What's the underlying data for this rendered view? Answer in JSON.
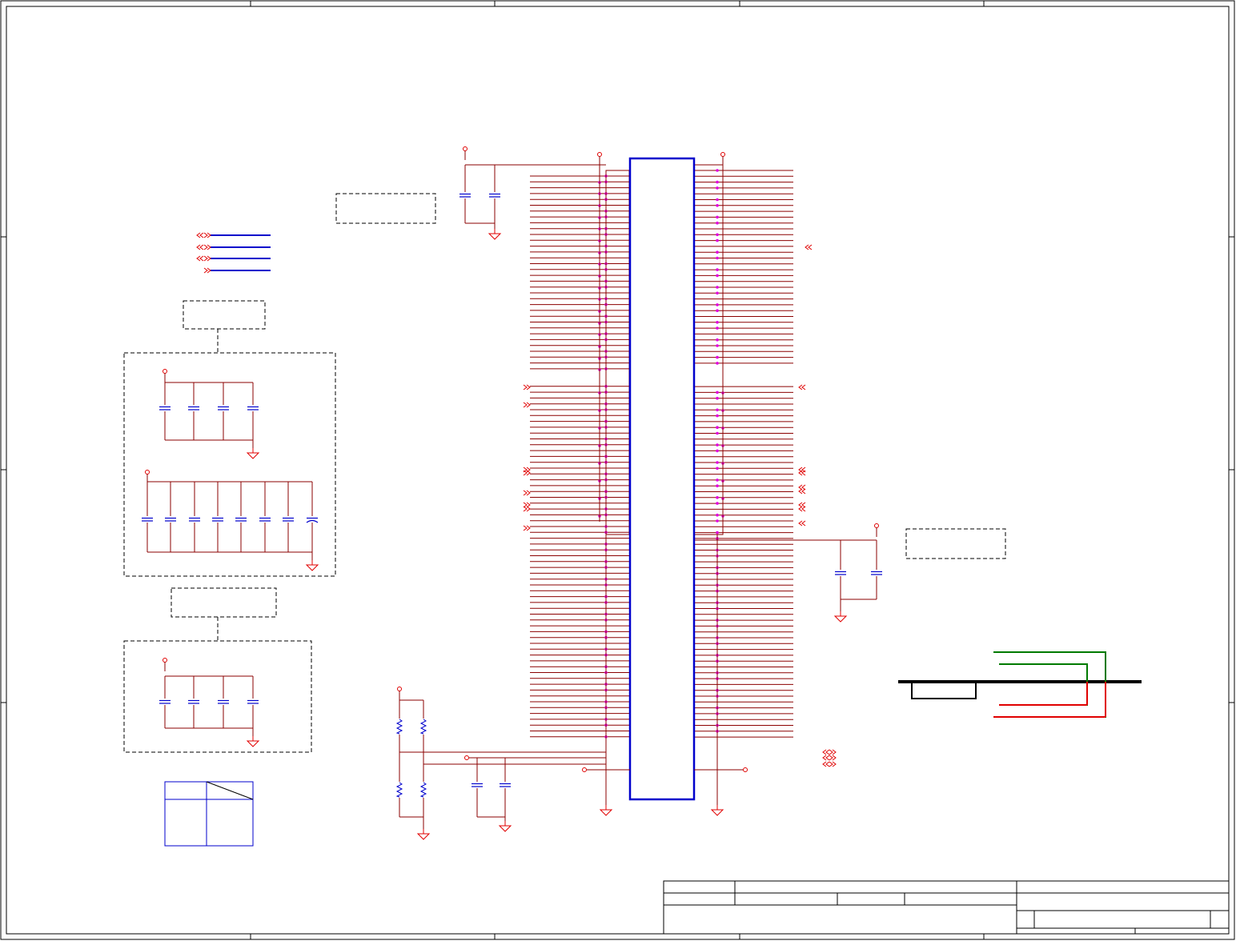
{
  "colors": {
    "wire": "#8b0000",
    "net": "#e00000",
    "junction": "#e000e0",
    "part": "#0000cc",
    "frame": "#000000",
    "green": "#007a00",
    "bus": "#000000"
  },
  "icons": [
    "ground-icon",
    "power-pin-icon",
    "capacitor-icon",
    "resistor-icon",
    "offpage-connector-icon"
  ]
}
